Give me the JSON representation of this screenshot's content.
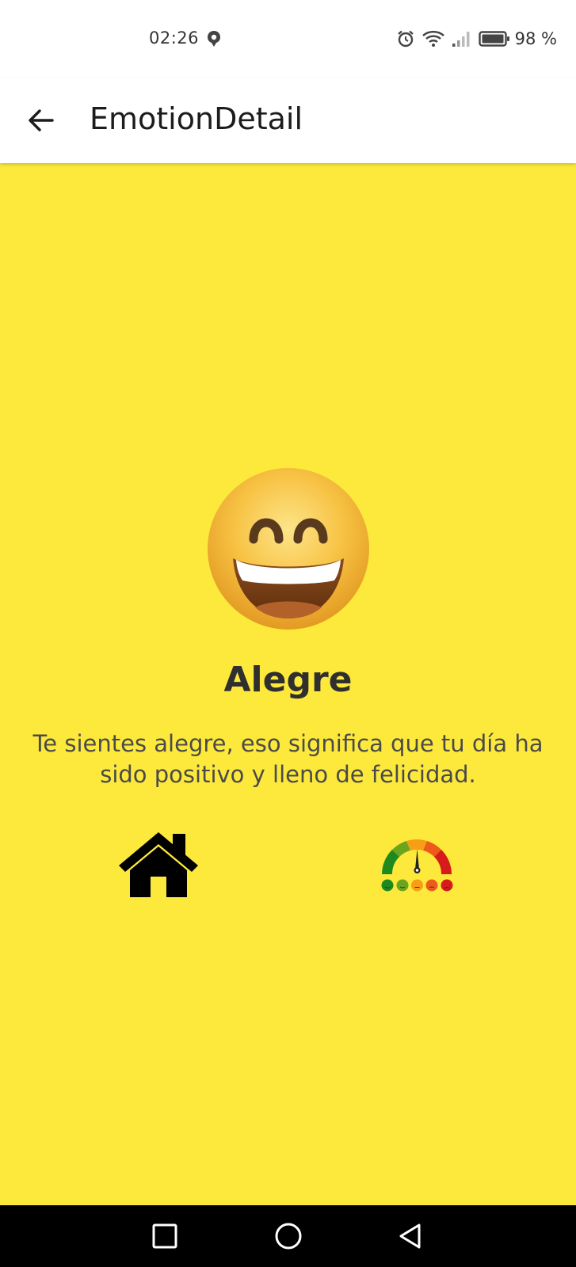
{
  "status_bar": {
    "time": "02:26",
    "battery_percent": "98 %",
    "icons": [
      "notification-icon",
      "alarm-icon",
      "wifi-icon",
      "signal-icon",
      "battery-icon"
    ]
  },
  "app_bar": {
    "title": "EmotionDetail",
    "back_icon": "arrow-left-icon"
  },
  "emotion": {
    "emoji_icon": "grinning-face-smiling-eyes-icon",
    "name": "Alegre",
    "description": "Te sientes alegre, eso significa que tu día ha sido positivo y lleno de felicidad.",
    "background_color": "#FDE93B"
  },
  "actions": {
    "home_icon": "home-icon",
    "meter_icon": "emotion-meter-icon"
  },
  "nav_bar": {
    "buttons": [
      "recents-square-icon",
      "home-circle-icon",
      "back-triangle-icon"
    ]
  }
}
